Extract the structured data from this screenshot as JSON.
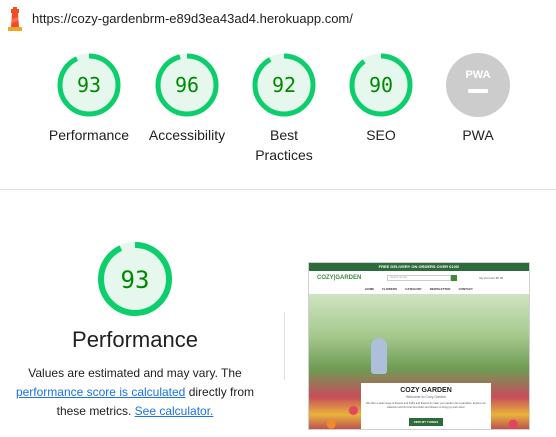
{
  "url": "https://cozy-gardenbrm-e89d3ea43ad4.herokuapp.com/",
  "colors": {
    "pass": "#0cce6b",
    "pass_text": "#008800",
    "pass_fill": "#e6f8ee",
    "na": "#cccccc",
    "link": "#1a73e8"
  },
  "icons": {
    "logo": "lighthouse-icon"
  },
  "scores": [
    {
      "value": "93",
      "label": "Performance"
    },
    {
      "value": "96",
      "label": "Accessibility"
    },
    {
      "value": "92",
      "label": "Best Practices"
    },
    {
      "value": "90",
      "label": "SEO"
    }
  ],
  "pwa": {
    "label": "PWA",
    "badge": "PWA"
  },
  "performance": {
    "score": "93",
    "title": "Performance",
    "desc_before": "Values are estimated and may vary. The ",
    "score_link": "performance score is calculated",
    "desc_middle": " directly from these metrics. ",
    "calc_link": "See calculator."
  },
  "screenshot": {
    "banner": "FREE DELIVERY ON ORDERS OVER €100!",
    "logo": "COZY|GARDEN",
    "search_placeholder": "Search our site",
    "util": "My Account   €0.00",
    "nav": [
      "HOME",
      "FLOWERS",
      "CATEGORY",
      "NEWSLETTER",
      "CONTACT"
    ],
    "hero_title": "COZY GARDEN",
    "hero_sub": "Welcome to Cozy Garden",
    "hero_text": "We offer a wide range of flowers and bulbs and flowers to make your garden into a paradise. Explore our collection and find the best bulbs and flowers to bring joy and colour.",
    "hero_button": "FIND MY THINGS"
  }
}
